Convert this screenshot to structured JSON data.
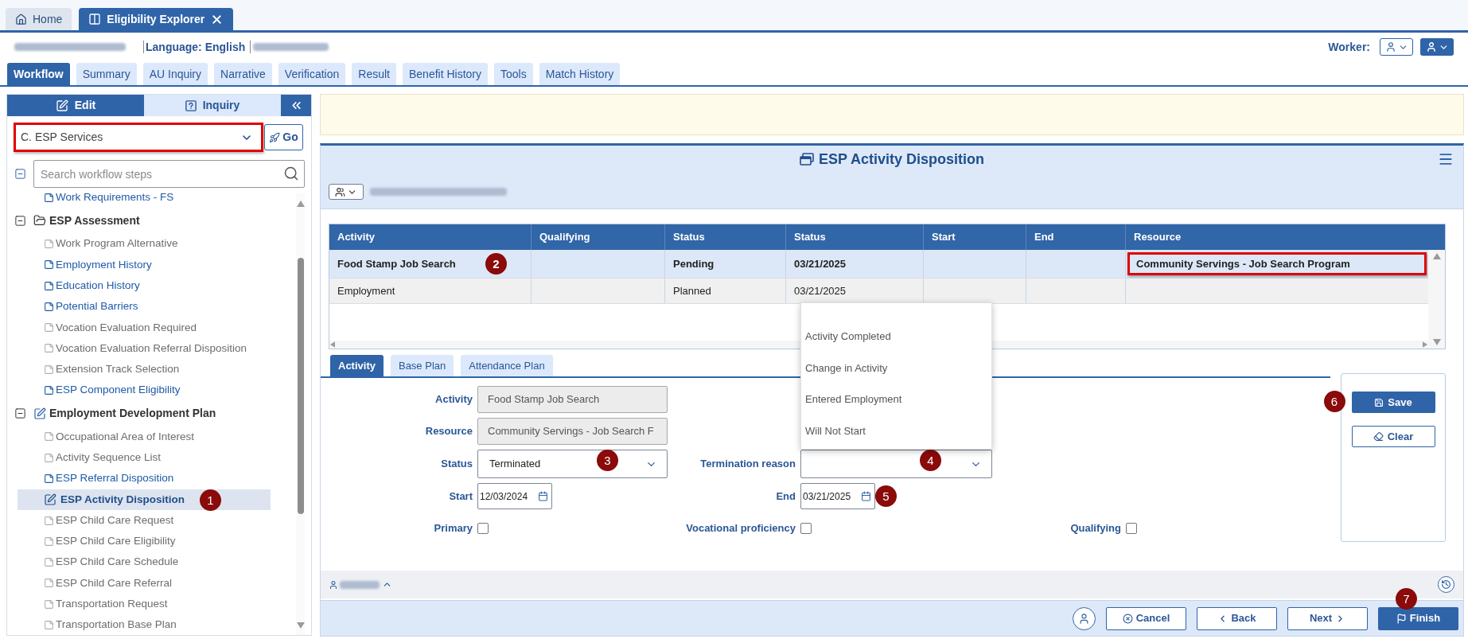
{
  "top_tabs": [
    {
      "kind": "home",
      "label": "Home",
      "selected": false,
      "closable": false
    },
    {
      "kind": "app",
      "label": "Eligibility Explorer",
      "selected": true,
      "closable": true
    }
  ],
  "header": {
    "language": "Language: English",
    "worker_label": "Worker:"
  },
  "nav_tabs": [
    {
      "label": "Workflow",
      "selected": true
    },
    {
      "label": "Summary",
      "selected": false
    },
    {
      "label": "AU Inquiry",
      "selected": false
    },
    {
      "label": "Narrative",
      "selected": false
    },
    {
      "label": "Verification",
      "selected": false
    },
    {
      "label": "Result",
      "selected": false
    },
    {
      "label": "Benefit History",
      "selected": false
    },
    {
      "label": "Tools",
      "selected": false
    },
    {
      "label": "Match History",
      "selected": false
    }
  ],
  "sidebar": {
    "modes": [
      {
        "kind": "edit",
        "label": "Edit",
        "selected": true
      },
      {
        "kind": "inquiry",
        "label": "Inquiry",
        "selected": false
      }
    ],
    "section_select": {
      "value": "C. ESP Services",
      "highlighted": true
    },
    "go_button": "Go",
    "search": {
      "placeholder": "Search workflow steps"
    },
    "tree": [
      {
        "kind": "step",
        "label": "Work Requirements - FS",
        "enabled": true,
        "selected": false
      },
      {
        "kind": "group",
        "label": "ESP Assessment",
        "expanded": true,
        "current": false,
        "children": [
          {
            "kind": "step",
            "label": "Work Program Alternative",
            "enabled": false,
            "selected": false
          },
          {
            "kind": "step",
            "label": "Employment History",
            "enabled": true,
            "selected": false
          },
          {
            "kind": "step",
            "label": "Education History",
            "enabled": true,
            "selected": false
          },
          {
            "kind": "step",
            "label": "Potential Barriers",
            "enabled": true,
            "selected": false
          },
          {
            "kind": "step",
            "label": "Vocation Evaluation Required",
            "enabled": false,
            "selected": false
          },
          {
            "kind": "step",
            "label": "Vocation Evaluation Referral Disposition",
            "enabled": false,
            "selected": false
          },
          {
            "kind": "step",
            "label": "Extension Track Selection",
            "enabled": false,
            "selected": false
          },
          {
            "kind": "step",
            "label": "ESP Component Eligibility",
            "enabled": true,
            "selected": false
          }
        ]
      },
      {
        "kind": "group",
        "label": "Employment Development Plan",
        "expanded": true,
        "current": true,
        "children": [
          {
            "kind": "step",
            "label": "Occupational Area of Interest",
            "enabled": false,
            "selected": false
          },
          {
            "kind": "step",
            "label": "Activity Sequence List",
            "enabled": false,
            "selected": false
          },
          {
            "kind": "step",
            "label": "ESP Referral Disposition",
            "enabled": true,
            "selected": false
          },
          {
            "kind": "step",
            "label": "ESP Activity Disposition",
            "enabled": true,
            "selected": true,
            "marker": "1"
          },
          {
            "kind": "step",
            "label": "ESP Child Care Request",
            "enabled": false,
            "selected": false
          },
          {
            "kind": "step",
            "label": "ESP Child Care Eligibility",
            "enabled": false,
            "selected": false
          },
          {
            "kind": "step",
            "label": "ESP Child Care Schedule",
            "enabled": false,
            "selected": false
          },
          {
            "kind": "step",
            "label": "ESP Child Care Referral",
            "enabled": false,
            "selected": false
          },
          {
            "kind": "step",
            "label": "Transportation Request",
            "enabled": false,
            "selected": false
          },
          {
            "kind": "step",
            "label": "Transportation Base Plan",
            "enabled": false,
            "selected": false
          }
        ]
      }
    ]
  },
  "page": {
    "title": "ESP Activity Disposition",
    "table": {
      "columns": [
        "Activity",
        "Qualifying",
        "Status",
        "Status",
        "Start",
        "End",
        "Resource"
      ],
      "rows": [
        {
          "selected": true,
          "cells": [
            {
              "text": "Food Stamp Job Search",
              "marker": "2"
            },
            null,
            {
              "text": "Pending"
            },
            {
              "text": "03/21/2025"
            },
            null,
            null,
            {
              "text": "Community Servings - Job Search Program",
              "highlighted": true
            }
          ]
        },
        {
          "selected": false,
          "cells": [
            {
              "text": "Employment"
            },
            null,
            {
              "text": "Planned"
            },
            {
              "text": "03/21/2025"
            },
            null,
            null,
            null
          ]
        }
      ]
    },
    "form_tabs": [
      {
        "label": "Activity",
        "selected": true
      },
      {
        "label": "Base Plan",
        "selected": false
      },
      {
        "label": "Attendance Plan",
        "selected": false
      }
    ],
    "form": {
      "rows": [
        [
          {
            "kind": "text",
            "label": "Activity",
            "value": "Food Stamp Job Search",
            "disabled": true
          }
        ],
        [
          {
            "kind": "text",
            "label": "Resource",
            "value": "Community Servings - Job Search F",
            "disabled": true
          }
        ],
        [
          {
            "kind": "select",
            "label": "Status",
            "value": "Terminated",
            "marker": "3"
          },
          {
            "kind": "select",
            "label": "Termination reason",
            "marker": "4",
            "expanded": true,
            "options": [
              "Activity Completed",
              "Change in Activity",
              "Entered Employment",
              "Will Not Start"
            ]
          }
        ],
        [
          {
            "kind": "date",
            "label": "Start",
            "value": "12/03/2024"
          },
          {
            "kind": "date",
            "label": "End",
            "value": "03/21/2025",
            "marker": "5"
          }
        ],
        [
          {
            "kind": "checkbox",
            "label": "Primary",
            "checked": false
          },
          {
            "kind": "checkbox",
            "label": "Vocational proficiency",
            "checked": false
          },
          {
            "kind": "checkbox",
            "label": "Qualifying",
            "checked": false
          }
        ]
      ]
    },
    "side_buttons": [
      {
        "kind": "save",
        "label": "Save",
        "primary": true,
        "marker": "6"
      },
      {
        "kind": "clear",
        "label": "Clear",
        "primary": false
      }
    ],
    "actions": [
      {
        "kind": "cancel",
        "label": "Cancel",
        "primary": false
      },
      {
        "kind": "back",
        "label": "Back",
        "primary": false
      },
      {
        "kind": "next",
        "label": "Next",
        "primary": false
      },
      {
        "kind": "finish",
        "label": "Finish",
        "primary": true,
        "marker": "7"
      }
    ]
  }
}
